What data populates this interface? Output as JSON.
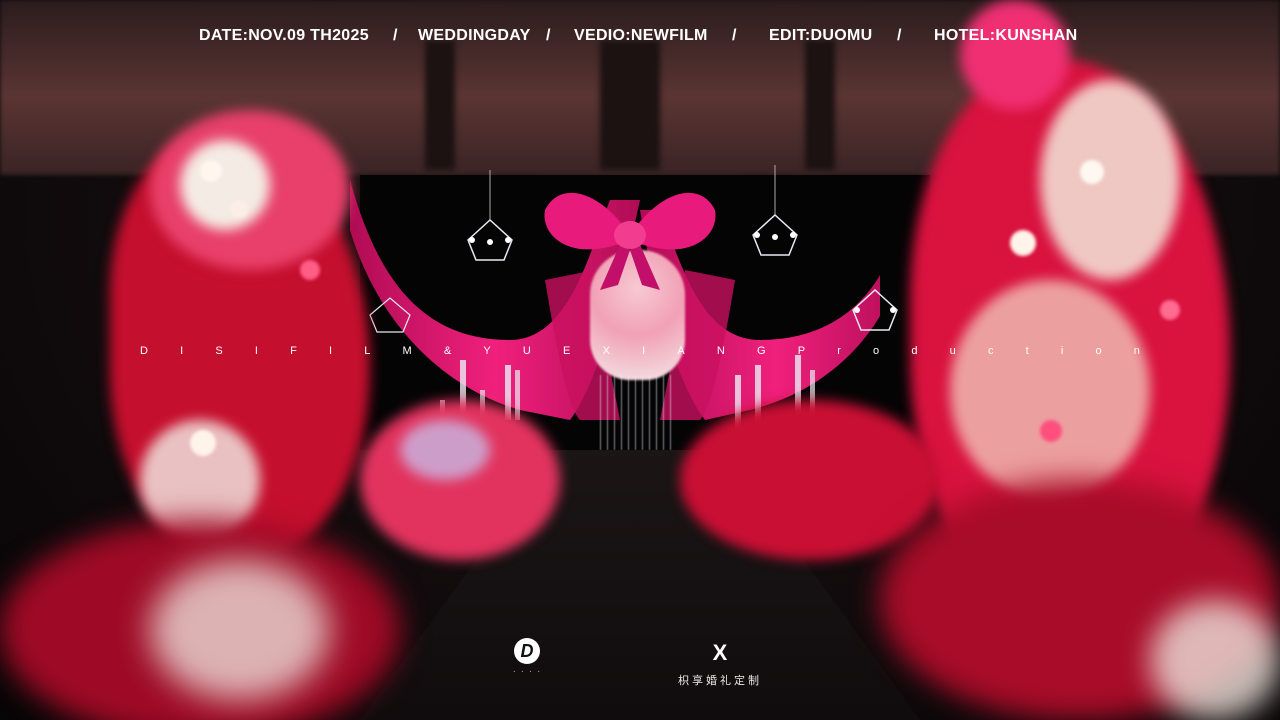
{
  "header": {
    "items": [
      "DATE:NOV.09 TH2025",
      "/",
      "WEDDINGDAY",
      "/",
      "VEDIO:NEWFILM",
      "/",
      "EDIT:DUOMU",
      "/",
      "HOTEL:KUNSHAN"
    ]
  },
  "credit": {
    "letters": [
      "D",
      "I",
      "S",
      "I",
      "F",
      "I",
      "L",
      "M",
      "&",
      "Y",
      "U",
      "E",
      "X",
      "I",
      "A",
      "N",
      "G",
      "P",
      "r",
      "o",
      "d",
      "u",
      "c",
      "t",
      "i",
      "o",
      "n"
    ]
  },
  "logos": {
    "left": {
      "mark": "D"
    },
    "right": {
      "mark": "X",
      "caption": "枳享婚礼定制"
    }
  },
  "colors": {
    "curtain": "#e0146e",
    "bow": "#e81a7c",
    "rose_red": "#d8102f",
    "rose_pink": "#f04a7a",
    "cream": "#f5e6dc"
  }
}
